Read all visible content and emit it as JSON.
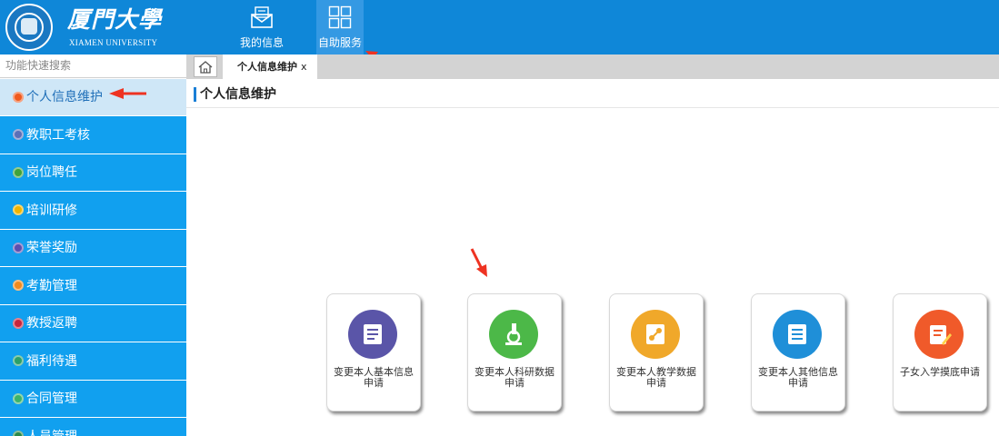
{
  "header": {
    "logo_cn": "厦門大學",
    "logo_en": "XIAMEN UNIVERSITY",
    "nav": [
      {
        "label": "我的信息",
        "icon": "envelope-icon"
      },
      {
        "label": "自助服务",
        "icon": "grid-icon"
      }
    ]
  },
  "search": {
    "placeholder": "功能快速搜索"
  },
  "sidebar": {
    "items": [
      {
        "label": "个人信息维护",
        "icon": "gear-icon",
        "color": "#f05a1e",
        "active": true
      },
      {
        "label": "教职工考核",
        "icon": "clipboard-icon",
        "color": "#5b6fb8"
      },
      {
        "label": "岗位聘任",
        "icon": "person-icon",
        "color": "#3fa33a"
      },
      {
        "label": "培训研修",
        "icon": "book-icon",
        "color": "#f0b400"
      },
      {
        "label": "荣誉奖励",
        "icon": "medal-icon",
        "color": "#5b4fb0"
      },
      {
        "label": "考勤管理",
        "icon": "clock-icon",
        "color": "#f08a1e"
      },
      {
        "label": "教授返聘",
        "icon": "id-card-icon",
        "color": "#c8243c"
      },
      {
        "label": "福利待遇",
        "icon": "gift-icon",
        "color": "#2aa06a"
      },
      {
        "label": "合同管理",
        "icon": "document-icon",
        "color": "#3bb36a"
      },
      {
        "label": "人员管理",
        "icon": "people-icon",
        "color": "#2a8a4a"
      }
    ]
  },
  "tabbar": {
    "home_icon": "home-icon",
    "tabs": [
      {
        "label": "个人信息维护",
        "close": "x"
      }
    ]
  },
  "main": {
    "title": "个人信息维护",
    "cards": [
      {
        "line1": "变更本人基本信息",
        "line2": "申请",
        "color": "#5a55a8",
        "icon": "profile-document-icon"
      },
      {
        "line1": "变更本人科研数据",
        "line2": "申请",
        "color": "#4cb848",
        "icon": "microscope-icon"
      },
      {
        "line1": "变更本人教学数据",
        "line2": "申请",
        "color": "#f0a82a",
        "icon": "teaching-data-icon"
      },
      {
        "line1": "变更本人其他信息",
        "line2": "申请",
        "color": "#1f8fd8",
        "icon": "list-document-icon"
      },
      {
        "line1": "子女入学摸底申请",
        "line2": "",
        "color": "#f05a2a",
        "icon": "edit-document-icon"
      }
    ]
  },
  "colors": {
    "topbar": "#0f87d8",
    "sidebar": "#11a0ef",
    "sidebar_active": "#cfe7f7",
    "annotation_arrow": "#ee3322"
  }
}
